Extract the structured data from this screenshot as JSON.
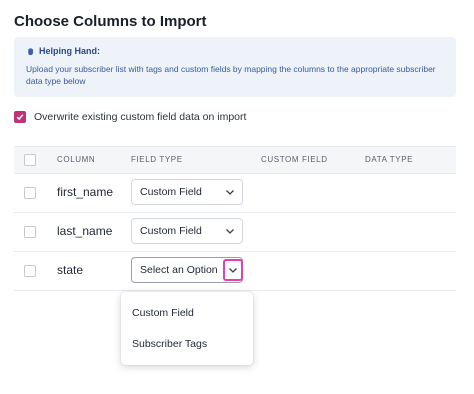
{
  "page": {
    "title": "Choose Columns to Import"
  },
  "help": {
    "icon": "hand-icon",
    "heading": "Helping Hand:",
    "body": "Upload your subscriber list with tags and custom fields by mapping the columns to the appropriate subscriber data type below"
  },
  "overwrite": {
    "checked": true,
    "label": "Overwrite existing custom field data on import"
  },
  "table": {
    "headers": [
      "COLUMN",
      "FIELD TYPE",
      "CUSTOM FIELD",
      "DATA TYPE"
    ],
    "rows": [
      {
        "column": "first_name",
        "field_type": "Custom Field"
      },
      {
        "column": "last_name",
        "field_type": "Custom Field"
      },
      {
        "column": "state",
        "field_type": "Select an Option"
      }
    ]
  },
  "dropdown": {
    "options": [
      "Custom Field",
      "Subscriber Tags"
    ]
  },
  "colors": {
    "accent": "#c0327a",
    "highlight": "#e53fb0",
    "help_bg": "#eef3fa"
  }
}
